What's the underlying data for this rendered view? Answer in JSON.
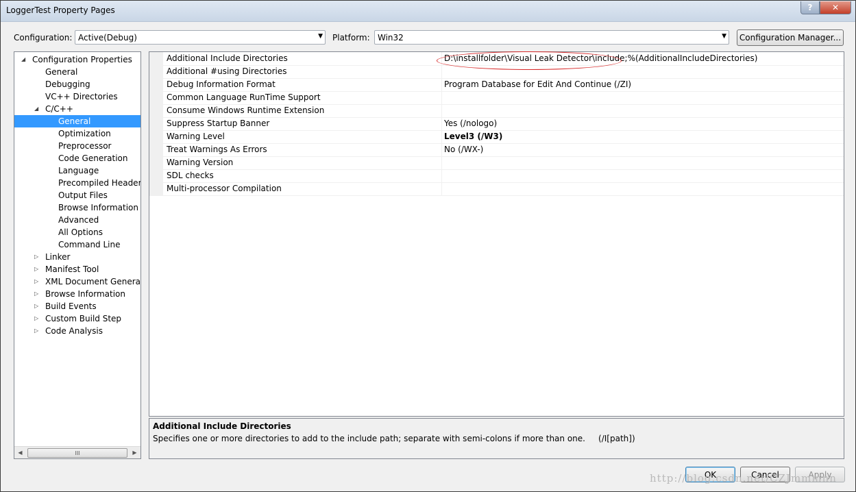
{
  "window": {
    "title": "LoggerTest Property Pages",
    "help_glyph": "?",
    "close_glyph": "✕"
  },
  "toolbar": {
    "configuration_label": "Configuration:",
    "configuration_value": "Active(Debug)",
    "platform_label": "Platform:",
    "platform_value": "Win32",
    "config_manager_label": "Configuration Manager..."
  },
  "tree": {
    "items": [
      {
        "label": "Configuration Properties",
        "level": 0,
        "state": "expanded"
      },
      {
        "label": "General",
        "level": 1
      },
      {
        "label": "Debugging",
        "level": 1
      },
      {
        "label": "VC++ Directories",
        "level": 1
      },
      {
        "label": "C/C++",
        "level": 1,
        "state": "expanded"
      },
      {
        "label": "General",
        "level": 2,
        "selected": true
      },
      {
        "label": "Optimization",
        "level": 2
      },
      {
        "label": "Preprocessor",
        "level": 2
      },
      {
        "label": "Code Generation",
        "level": 2
      },
      {
        "label": "Language",
        "level": 2
      },
      {
        "label": "Precompiled Headers",
        "level": 2
      },
      {
        "label": "Output Files",
        "level": 2
      },
      {
        "label": "Browse Information",
        "level": 2
      },
      {
        "label": "Advanced",
        "level": 2
      },
      {
        "label": "All Options",
        "level": 2
      },
      {
        "label": "Command Line",
        "level": 2
      },
      {
        "label": "Linker",
        "level": 1,
        "state": "collapsed"
      },
      {
        "label": "Manifest Tool",
        "level": 1,
        "state": "collapsed"
      },
      {
        "label": "XML Document Generator",
        "level": 1,
        "state": "collapsed"
      },
      {
        "label": "Browse Information",
        "level": 1,
        "state": "collapsed"
      },
      {
        "label": "Build Events",
        "level": 1,
        "state": "collapsed"
      },
      {
        "label": "Custom Build Step",
        "level": 1,
        "state": "collapsed"
      },
      {
        "label": "Code Analysis",
        "level": 1,
        "state": "collapsed"
      }
    ],
    "scroll_thumb_glyph": "III"
  },
  "properties": [
    {
      "name": "Additional Include Directories",
      "value": "D:\\installfolder\\Visual Leak Detector\\include;%(AdditionalIncludeDirectories)",
      "bold": false
    },
    {
      "name": "Additional #using Directories",
      "value": "",
      "bold": false
    },
    {
      "name": "Debug Information Format",
      "value": "Program Database for Edit And Continue (/ZI)",
      "bold": false
    },
    {
      "name": "Common Language RunTime Support",
      "value": "",
      "bold": false
    },
    {
      "name": "Consume Windows Runtime Extension",
      "value": "",
      "bold": false
    },
    {
      "name": "Suppress Startup Banner",
      "value": "Yes (/nologo)",
      "bold": false
    },
    {
      "name": "Warning Level",
      "value": "Level3 (/W3)",
      "bold": true
    },
    {
      "name": "Treat Warnings As Errors",
      "value": "No (/WX-)",
      "bold": false
    },
    {
      "name": "Warning Version",
      "value": "",
      "bold": false
    },
    {
      "name": "SDL checks",
      "value": "",
      "bold": false
    },
    {
      "name": "Multi-processor Compilation",
      "value": "",
      "bold": false
    }
  ],
  "description": {
    "title": "Additional Include Directories",
    "text": "Specifies one or more directories to add to the include path; separate with semi-colons if more than one.     (/I[path])"
  },
  "buttons": {
    "ok": "OK",
    "cancel": "Cancel",
    "apply": "Apply"
  },
  "watermark": "http://blog.csdn.net/CZJmmmnn",
  "colors": {
    "selection": "#3399ff",
    "highlight_ellipse": "#d72a2a"
  }
}
